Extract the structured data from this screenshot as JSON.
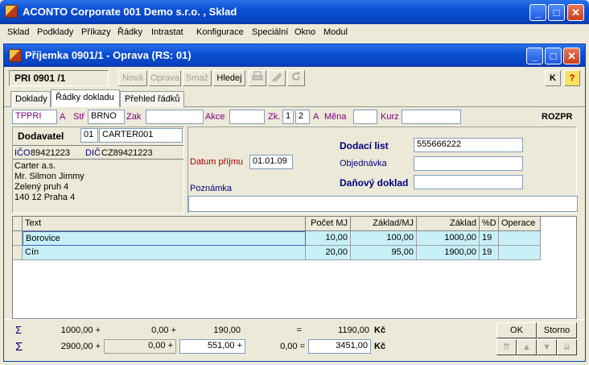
{
  "window": {
    "title": "ACONTO Corporate 001 Demo s.r.o. , Sklad",
    "min": "_",
    "max": "□",
    "close": "✕"
  },
  "menu": [
    "Sklad",
    "Podklady",
    "Příkazy",
    "Řádky",
    "Intrastat",
    "Konfigurace",
    "Speciální",
    "Okno",
    "Modul"
  ],
  "child": {
    "title": "Příjemka 0901/1 - Oprava   (RS: 01)"
  },
  "toolbar": {
    "doc_number": "PRI  0901  /1",
    "new": "Nová",
    "edit": "Oprava",
    "delete": "Smaž",
    "search": "Hledej",
    "k": "K",
    "help": "?"
  },
  "tabs": [
    "Doklady",
    "Řádky dokladu",
    "Přehled řádků"
  ],
  "header_fields": {
    "type": "TPPRI",
    "type_flag": "A",
    "str_label": "Stř",
    "str_value": "BRNO",
    "zak_label": "Zak",
    "akce_label": "Akce",
    "zk_label": "Zk.",
    "zk_1": "1",
    "zk_2": "2",
    "zk_flag": "A",
    "mena_label": "Měna",
    "kurz_label": "Kurz",
    "rozpr": "ROZPR"
  },
  "supplier": {
    "label": "Dodavatel",
    "code_prefix": "01",
    "code": "CARTER001",
    "ico_label": "IČO",
    "ico": "89421223",
    "dic_label": "DIČ",
    "dic": "CZ89421223",
    "address": [
      "Carter a.s.",
      "Mr. Silmon Jimmy",
      "Zelený pruh 4",
      "140 12 Praha 4"
    ]
  },
  "receipt": {
    "date_label": "Datum příjmu",
    "date": "01.01.09",
    "note_label": "Poznámka",
    "delivery_label": "Dodací list",
    "delivery": "555666222",
    "order_label": "Objednávka",
    "order": "",
    "tax_doc_label": "Daňový doklad",
    "tax_doc": ""
  },
  "grid": {
    "columns": [
      "Text",
      "Počet MJ",
      "Základ/MJ",
      "Základ",
      "%D",
      "Operace"
    ],
    "rows": [
      [
        "Borovice",
        "10,00",
        "100,00",
        "1000,00",
        "19",
        ""
      ],
      [
        "Cín",
        "20,00",
        "95,00",
        "1900,00",
        "19",
        ""
      ]
    ]
  },
  "summary": {
    "sigma": "Σ",
    "row1": [
      "1000,00 +",
      "0,00 +",
      "190,00",
      "=",
      "1190,00",
      "Kč"
    ],
    "row2": [
      "2900,00 +",
      "0,00 +",
      "551,00 +",
      "0,00 =",
      "3451,00",
      "Kč"
    ]
  },
  "buttons": {
    "ok": "OK",
    "storno": "Storno",
    "nav": [
      "⇈",
      "▲",
      "▼",
      "⇊"
    ]
  }
}
